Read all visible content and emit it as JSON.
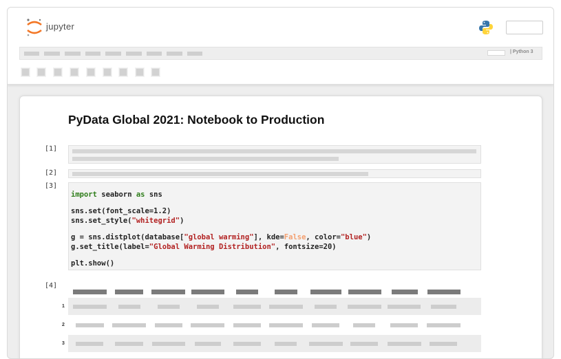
{
  "app": {
    "logo_text": "jupyter",
    "kernel_label": "| Python 3",
    "colors": {
      "accent_orange": "#f37726",
      "python_blue": "#3776ab",
      "python_yellow": "#ffd43b"
    }
  },
  "menubar": {
    "item_count": 9
  },
  "toolbar": {
    "button_count": 9
  },
  "notebook": {
    "title": "PyData Global 2021: Notebook to Production",
    "cells": [
      {
        "prompt": "[1]"
      },
      {
        "prompt": "[2]"
      },
      {
        "prompt": "[3]"
      },
      {
        "prompt": "[4]"
      }
    ],
    "code": {
      "l1_kw1": "import",
      "l1_mod": " seaborn ",
      "l1_kw2": "as",
      "l1_alias": " sns",
      "l2": "sns.set(font_scale=1.2)",
      "l3_a": "sns.set_style(",
      "l3_s": "\"whitegrid\"",
      "l3_b": ")",
      "l4_a": "g = sns.distplot(database[",
      "l4_s1": "\"global warming\"",
      "l4_b": "], kde=",
      "l4_k": "False",
      "l4_c": ", color=",
      "l4_s2": "\"blue\"",
      "l4_d": ")",
      "l5_a": "g.set_title(label=",
      "l5_s": "\"Global Warming Distribution\"",
      "l5_b": ", fontsize=20)",
      "l6": "plt.show()"
    },
    "dataframe": {
      "row_indices": [
        "1",
        "2",
        "3"
      ]
    }
  }
}
